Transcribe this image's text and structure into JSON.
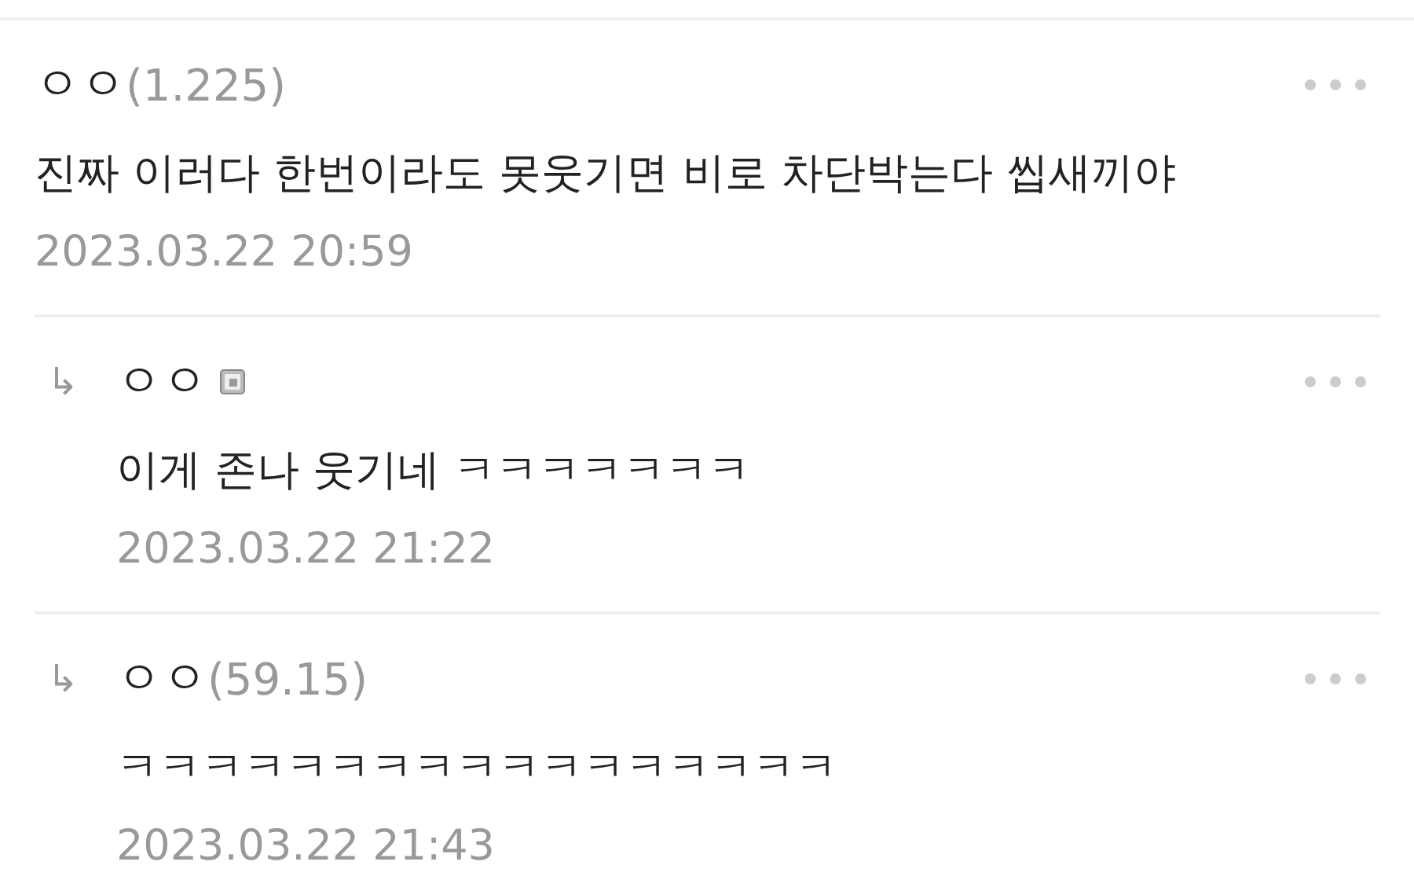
{
  "comments": [
    {
      "kind": "comment",
      "name": "ㅇㅇ",
      "ip": "(1.225)",
      "text": "진짜 이러다 한번이라도 못웃기면 비로 차단박는다 씹새끼야",
      "date": "2023.03.22 20:59"
    },
    {
      "kind": "reply",
      "reply_mark": "↳",
      "name": "ㅇㅇ",
      "member_icon": true,
      "text": "이게 존나 웃기네 ㅋㅋㅋㅋㅋㅋㅋ",
      "date": "2023.03.22 21:22"
    },
    {
      "kind": "reply",
      "reply_mark": "↳",
      "name": "ㅇㅇ",
      "ip": "(59.15)",
      "text": "ㅋㅋㅋㅋㅋㅋㅋㅋㅋㅋㅋㅋㅋㅋㅋㅋㅋ",
      "date": "2023.03.22 21:43"
    }
  ]
}
